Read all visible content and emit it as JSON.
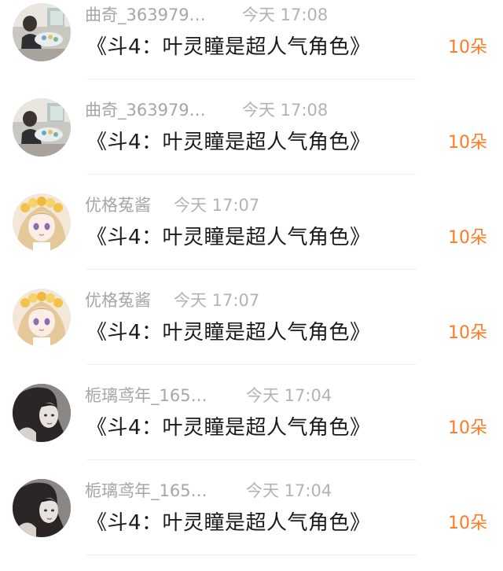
{
  "items": [
    {
      "avatar_icon": "user-avatar-painter",
      "username": "曲奇_363979…",
      "time": "今天 17:08",
      "message": "《斗4：叶灵瞳是超人气角色》",
      "gift": "10朵"
    },
    {
      "avatar_icon": "user-avatar-painter",
      "username": "曲奇_363979…",
      "time": "今天 17:08",
      "message": "《斗4：叶灵瞳是超人气角色》",
      "gift": "10朵"
    },
    {
      "avatar_icon": "user-avatar-anime-girl",
      "username": "优格菟酱",
      "time": "今天 17:07",
      "message": "《斗4：叶灵瞳是超人气角色》",
      "gift": "10朵"
    },
    {
      "avatar_icon": "user-avatar-anime-girl",
      "username": "优格菟酱",
      "time": "今天 17:07",
      "message": "《斗4：叶灵瞳是超人气角色》",
      "gift": "10朵"
    },
    {
      "avatar_icon": "user-avatar-dark-portrait",
      "username": "栀璃鸢年_165…",
      "time": "今天 17:04",
      "message": "《斗4：叶灵瞳是超人气角色》",
      "gift": "10朵"
    },
    {
      "avatar_icon": "user-avatar-dark-portrait",
      "username": "栀璃鸢年_165…",
      "time": "今天 17:04",
      "message": "《斗4：叶灵瞳是超人气角色》",
      "gift": "10朵"
    }
  ],
  "colors": {
    "username": "#a6a6a6",
    "time": "#b3b3b3",
    "message": "#1a1a1a",
    "gift_accent": "#ff7a22",
    "divider": "#efefef"
  }
}
